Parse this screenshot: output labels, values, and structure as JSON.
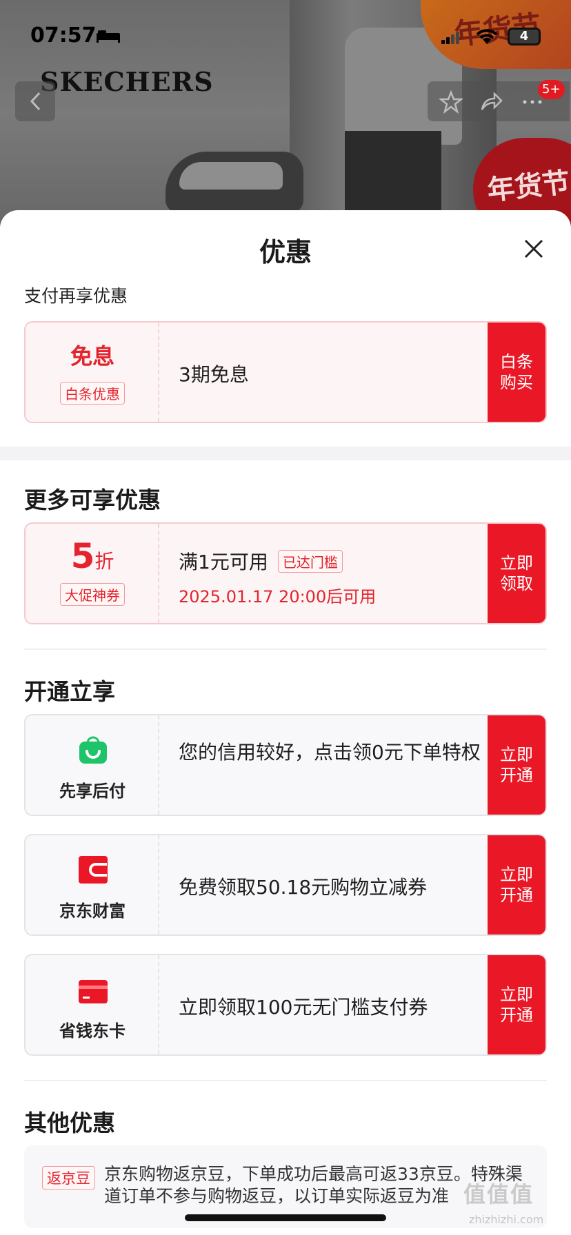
{
  "status_bar": {
    "time": "07:57",
    "battery": "4"
  },
  "header": {
    "brand": "SKECHERS",
    "festival_text": "年货节",
    "badge": "5+"
  },
  "sheet": {
    "title": "优惠",
    "pay_section": {
      "label": "支付再享优惠",
      "card": {
        "left_title": "免息",
        "left_tag": "白条优惠",
        "text": "3期免息",
        "cta_line1": "白条",
        "cta_line2": "购买"
      }
    },
    "more_section": {
      "title": "更多可享优惠",
      "card": {
        "discount_num": "5",
        "discount_unit": "折",
        "left_tag": "大促神券",
        "condition": "满1元可用",
        "status_tag": "已达门槛",
        "date_text": "2025.01.17 20:00后可用",
        "cta_line1": "立即",
        "cta_line2": "领取"
      }
    },
    "open_section": {
      "title": "开通立享",
      "items": [
        {
          "label": "先享后付",
          "text": "您的信用较好，点击领0元下单特权",
          "cta_line1": "立即",
          "cta_line2": "开通",
          "icon": "green-bag-icon"
        },
        {
          "label": "京东财富",
          "text": "免费领取50.18元购物立减券",
          "cta_line1": "立即",
          "cta_line2": "开通",
          "icon": "red-wallet-icon"
        },
        {
          "label": "省钱东卡",
          "text": "立即领取100元无门槛支付券",
          "cta_line1": "立即",
          "cta_line2": "开通",
          "icon": "red-card-icon"
        }
      ]
    },
    "other_section": {
      "title": "其他优惠",
      "tag": "返京豆",
      "text": "京东购物返京豆，下单成功后最高可返33京豆。特殊渠道订单不参与购物返豆，以订单实际返豆为准"
    }
  },
  "watermark": {
    "main": "值值值",
    "sub": "zhizhizhi.com"
  },
  "colors": {
    "accent_red": "#ea1826",
    "green": "#1fc36a"
  }
}
